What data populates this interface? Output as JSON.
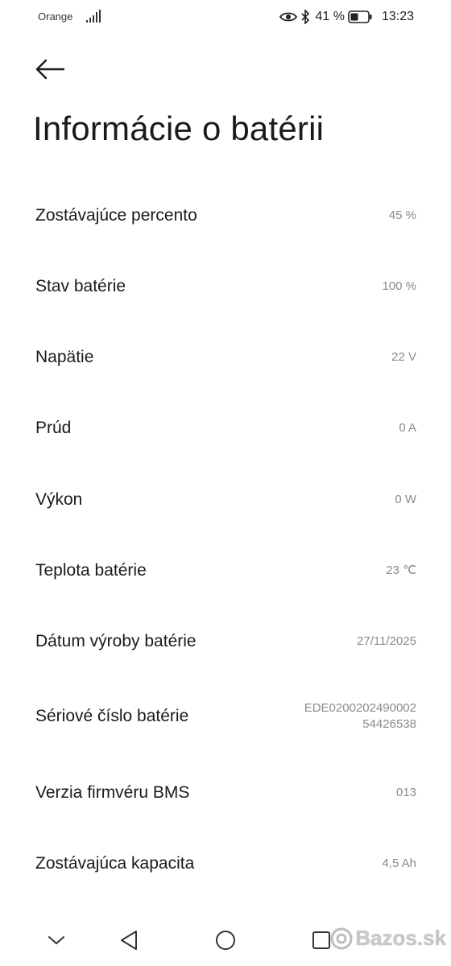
{
  "status_bar": {
    "carrier": "Orange",
    "battery_percent": "41 %",
    "time": "13:23",
    "icons": [
      "signal-icon",
      "eye-icon",
      "bluetooth-icon",
      "battery-icon"
    ]
  },
  "header": {
    "back_icon": "arrow-left-icon",
    "title": "Informácie o batérii"
  },
  "rows": [
    {
      "label": "Zostávajúce percento",
      "value": [
        "45 %"
      ]
    },
    {
      "label": "Stav batérie",
      "value": [
        "100 %"
      ]
    },
    {
      "label": "Napätie",
      "value": [
        "22 V"
      ]
    },
    {
      "label": "Prúd",
      "value": [
        "0 A"
      ]
    },
    {
      "label": "Výkon",
      "value": [
        "0 W"
      ]
    },
    {
      "label": "Teplota batérie",
      "value": [
        "23 ℃"
      ]
    },
    {
      "label": "Dátum výroby batérie",
      "value": [
        "27/11/2025"
      ]
    },
    {
      "label": "Sériové číslo batérie",
      "value": [
        "EDE0200202490002",
        "54426538"
      ]
    },
    {
      "label": "Verzia firmvéru BMS",
      "value": [
        "013"
      ]
    },
    {
      "label": "Zostávajúca kapacita",
      "value": [
        "4,5 Ah"
      ]
    }
  ],
  "nav_bar": {
    "buttons": [
      "chevron-down-icon",
      "back-triangle-icon",
      "home-circle-icon",
      "recents-square-icon"
    ]
  },
  "watermark": {
    "text": "Bazos.sk"
  }
}
